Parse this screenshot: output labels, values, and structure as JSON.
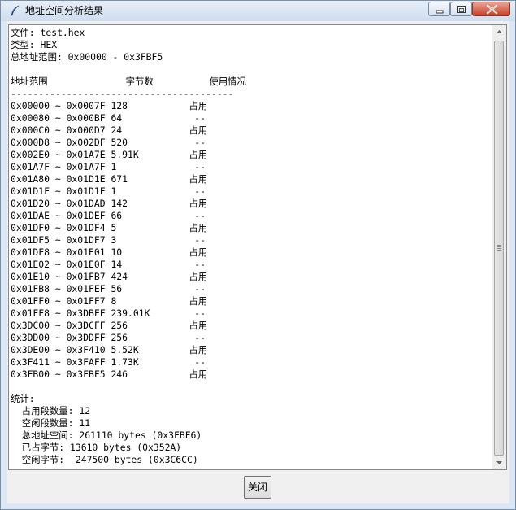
{
  "window": {
    "title": "地址空间分析结果",
    "close_button": "关闭"
  },
  "report": {
    "text": "文件: test.hex\n类型: HEX\n总地址范围: 0x00000 - 0x3FBF5\n\n地址范围              字节数          使用情况\n----------------------------------------\n0x00000 ~ 0x0007F 128           占用\n0x00080 ~ 0x000BF 64             --\n0x000C0 ~ 0x000D7 24            占用\n0x000D8 ~ 0x002DF 520            --\n0x002E0 ~ 0x01A7E 5.91K         占用\n0x01A7F ~ 0x01A7F 1              --\n0x01A80 ~ 0x01D1E 671           占用\n0x01D1F ~ 0x01D1F 1              --\n0x01D20 ~ 0x01DAD 142           占用\n0x01DAE ~ 0x01DEF 66             --\n0x01DF0 ~ 0x01DF4 5             占用\n0x01DF5 ~ 0x01DF7 3              --\n0x01DF8 ~ 0x01E01 10            占用\n0x01E02 ~ 0x01E0F 14             --\n0x01E10 ~ 0x01FB7 424           占用\n0x01FB8 ~ 0x01FEF 56             --\n0x01FF0 ~ 0x01FF7 8             占用\n0x01FF8 ~ 0x3DBFF 239.01K        --\n0x3DC00 ~ 0x3DCFF 256           占用\n0x3DD00 ~ 0x3DDFF 256            --\n0x3DE00 ~ 0x3F410 5.52K         占用\n0x3F411 ~ 0x3FAFF 1.73K          --\n0x3FB00 ~ 0x3FBF5 246           占用\n\n统计:\n  占用段数量: 12\n  空闲段数量: 11\n  总地址空间: 261110 bytes (0x3FBF6)\n  已占字节: 13610 bytes (0x352A)\n  空闲字节:  247500 bytes (0x3C6CC)"
  }
}
